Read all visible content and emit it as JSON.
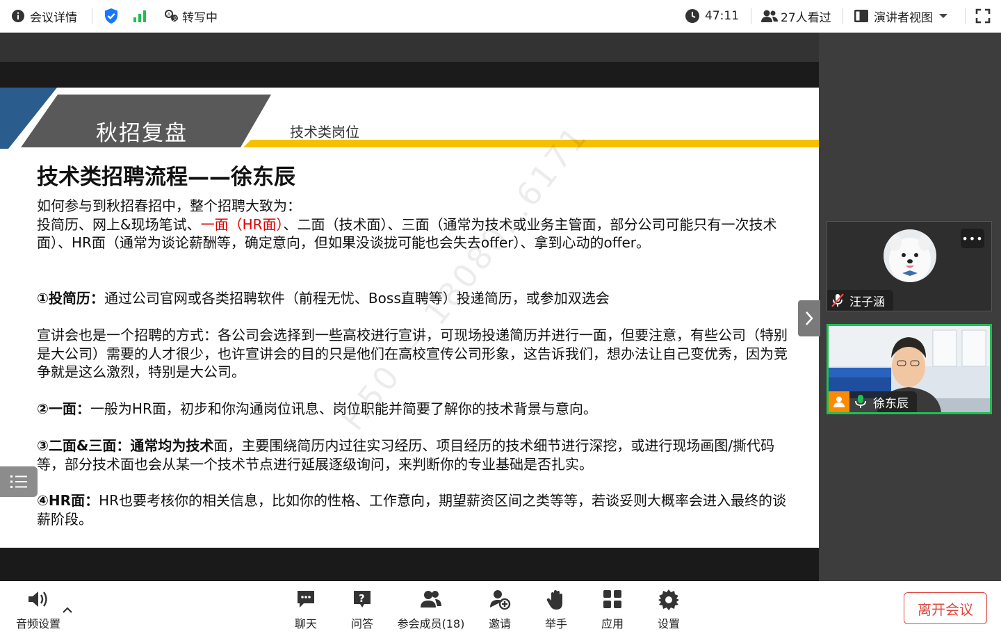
{
  "topbar": {
    "meeting_details": "会议详情",
    "transcribing": "转写中",
    "timer": "47:11",
    "viewers": "27人看过",
    "view_mode": "演讲者视图"
  },
  "slide": {
    "title": "秋招复盘",
    "subtitle": "技术类岗位",
    "heading": "技术类招聘流程——徐东辰",
    "intro_line1": "如何参与到秋招春招中，整个招聘大致为：",
    "intro_line2_a": "投简历、网上&现场笔试、",
    "intro_line2_red": "一面（HR面）",
    "intro_line2_b": "、二面（技术面）、三面（通常为技术或业务主管面，部分公司可能只有一次技术面）、HR面（通常为谈论薪酬等，确定意向，但如果没谈拢可能也会失去offer）、拿到心动的offer。",
    "s1_label": "①投简历：",
    "s1_text": "通过公司官网或各类招聘软件（前程无忧、Boss直聘等）投递简历，或参加双选会",
    "s1b_text": "宣讲会也是一个招聘的方式：各公司会选择到一些高校进行宣讲，可现场投递简历并进行一面，但要注意，有些公司（特别是大公司）需要的人才很少，也许宣讲会的目的只是他们在高校宣传公司形象，这告诉我们，想办法让自己变优秀，因为竞争就是这么激烈，特别是大公司。",
    "s2_label": "②一面：",
    "s2_text": "一般为HR面，初步和你沟通岗位讯息、岗位职能并简要了解你的技术背景与意向。",
    "s3_label": "③二面&三面：通常均为技术",
    "s3_text": "面，主要围绕简历内过往实习经历、项目经历的技术细节进行深挖，或进行现场画图/撕代码等，部分技术面也会从某一个技术节点进行延展逐级询问，来判断你的专业基础是否扎实。",
    "s4_label": "④HR面：",
    "s4_text": "HR也要考核你的相关信息，比如你的性格、工作意向，期望薪资区间之类等等，若谈妥则大概率会进入最终的谈薪阶段。",
    "watermark": "H50 — 18080…6171"
  },
  "participants": {
    "p1_name": "汪子涵",
    "p2_name": "徐东辰"
  },
  "bottombar": {
    "audio": "音频设置",
    "chat": "聊天",
    "qa": "问答",
    "members": "参会成员(18)",
    "invite": "邀请",
    "raise_hand": "举手",
    "apps": "应用",
    "settings": "设置",
    "leave": "离开会议"
  },
  "colors": {
    "accent_blue": "#1677ff",
    "leave_red": "#e0483f",
    "slide_yellow": "#f5c000",
    "slide_navy": "#2b5c8e",
    "active_speaker_green": "#1fbf52"
  }
}
